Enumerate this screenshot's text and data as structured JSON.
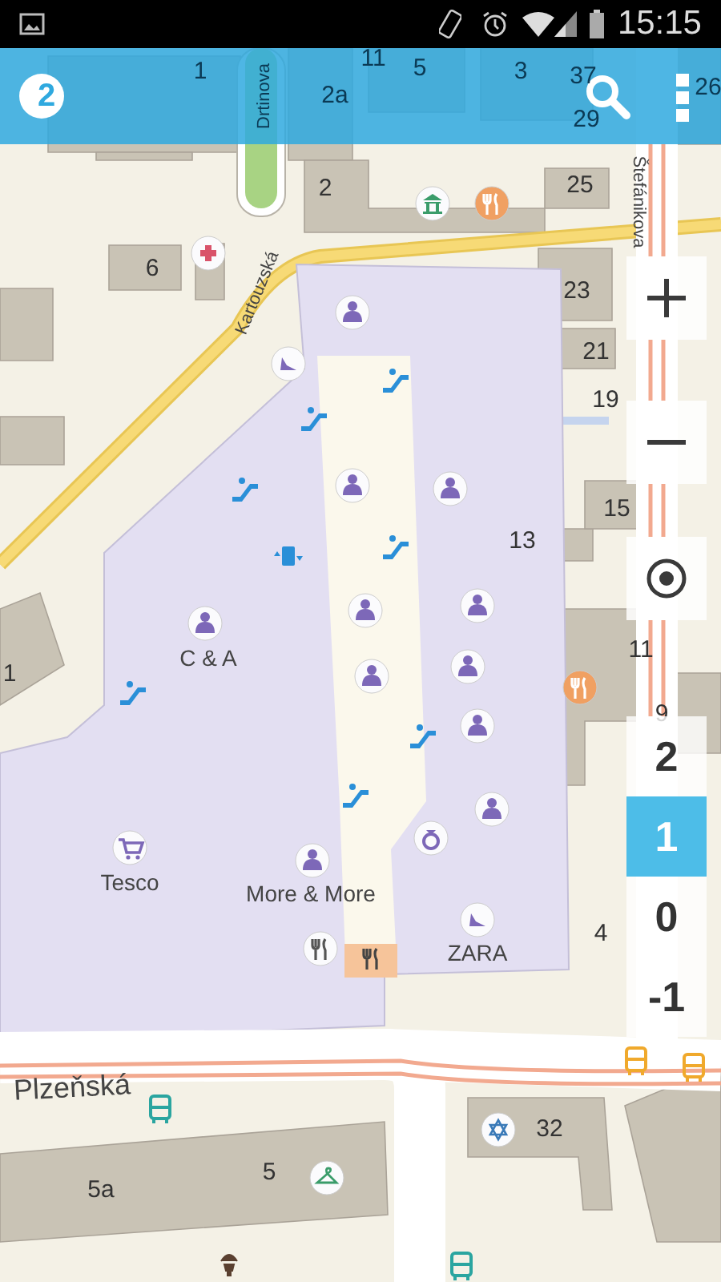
{
  "status_bar": {
    "time": "15:15"
  },
  "app_bar": {
    "logo_text": "2"
  },
  "map": {
    "labels": [
      "1",
      "11",
      "5",
      "2a",
      "3",
      "37",
      "29",
      "26",
      "2",
      "25",
      "6",
      "23",
      "21",
      "19",
      "15",
      "13",
      "11",
      "9",
      "4",
      "32",
      "5",
      "5a",
      "1"
    ],
    "streets": [
      "Drtinova",
      "Kartouzská",
      "Štefánikova",
      "Plzeňská"
    ],
    "stores": [
      "C & A",
      "Tesco",
      "More & More",
      "ZARA"
    ]
  },
  "floors": [
    {
      "label": "2",
      "selected": false
    },
    {
      "label": "1",
      "selected": true
    },
    {
      "label": "0",
      "selected": false
    },
    {
      "label": "-1",
      "selected": false
    }
  ]
}
